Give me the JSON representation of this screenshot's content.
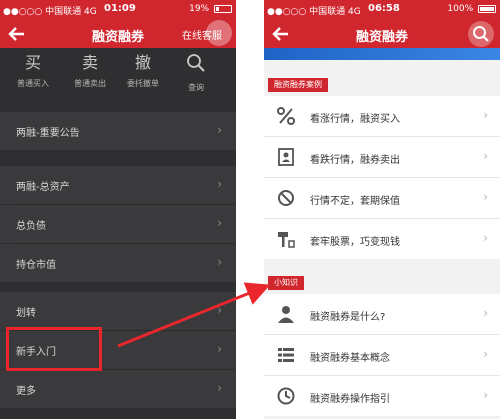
{
  "left_phone": {
    "status": {
      "carrier": "●●○○○ 中国联通 4G",
      "time": "01:09",
      "battery": "19%"
    },
    "nav": {
      "title": "融资融券",
      "right_label": "在线客服"
    },
    "quick_actions": [
      {
        "glyph": "买",
        "label": "普通买入"
      },
      {
        "glyph": "卖",
        "label": "普通卖出"
      },
      {
        "glyph": "撤",
        "label": "委托撤单"
      },
      {
        "glyph": "search-icon",
        "label": "查询"
      }
    ],
    "menu": [
      {
        "label": "两融-重要公告"
      },
      {
        "label": "两融-总资产"
      },
      {
        "label": "总负债"
      },
      {
        "label": "持仓市值"
      },
      {
        "label": "划转"
      },
      {
        "label": "新手入门"
      },
      {
        "label": "更多"
      }
    ],
    "highlight_color": "#e8262c"
  },
  "right_phone": {
    "status": {
      "carrier": "●●○○○ 中国联通 4G",
      "time": "06:58",
      "battery": "100%"
    },
    "nav": {
      "title": "融资融券"
    },
    "section1": {
      "tag": "融资融券案例",
      "items": [
        {
          "icon": "percent-icon",
          "label": "看涨行情，融资买入"
        },
        {
          "icon": "contact-card-icon",
          "label": "看跌行情，融券卖出"
        },
        {
          "icon": "no-entry-icon",
          "label": "行情不定，套期保值"
        },
        {
          "icon": "hammer-icon",
          "label": "套牢股票，巧变现钱"
        }
      ]
    },
    "section2": {
      "tag": "小知识",
      "items": [
        {
          "icon": "person-icon",
          "label": "融资融券是什么?"
        },
        {
          "icon": "list-icon",
          "label": "融资融券基本概念"
        },
        {
          "icon": "clock-icon",
          "label": "融资融券操作指引"
        }
      ]
    }
  },
  "colors": {
    "brand_red": "#d0262d",
    "dark_bg": "#2f2f31"
  }
}
